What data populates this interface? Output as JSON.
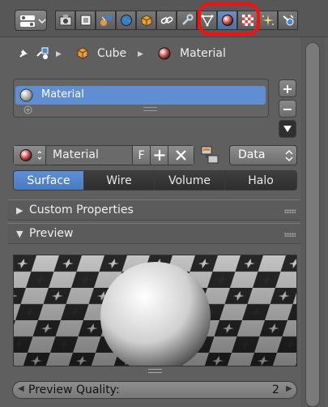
{
  "toolbar": {
    "tabs": [
      {
        "icon": "render-icon"
      },
      {
        "icon": "render-layers-icon"
      },
      {
        "icon": "scene-icon"
      },
      {
        "icon": "world-icon"
      },
      {
        "icon": "object-icon"
      },
      {
        "icon": "constraints-icon"
      },
      {
        "icon": "modifiers-icon"
      },
      {
        "icon": "object-data-icon"
      },
      {
        "icon": "material-icon",
        "active": true
      },
      {
        "icon": "texture-icon"
      },
      {
        "icon": "particles-icon"
      },
      {
        "icon": "physics-icon"
      }
    ]
  },
  "breadcrumb": {
    "object": "Cube",
    "material": "Material"
  },
  "material_slots": {
    "items": [
      {
        "label": "Material"
      }
    ],
    "add_symbol": "+",
    "remove_symbol": "−"
  },
  "id_block": {
    "name": "Material",
    "fake_user": "F",
    "link": "Data"
  },
  "tabs": [
    "Surface",
    "Wire",
    "Volume",
    "Halo"
  ],
  "panels": {
    "custom_properties": "Custom Properties",
    "preview": "Preview"
  },
  "preview_quality": {
    "label": "Preview Quality:",
    "value": "2"
  },
  "colors": {
    "accent": "#5f8ed3",
    "highlight": "#ff0d0d",
    "background": "#5f5f5f"
  }
}
